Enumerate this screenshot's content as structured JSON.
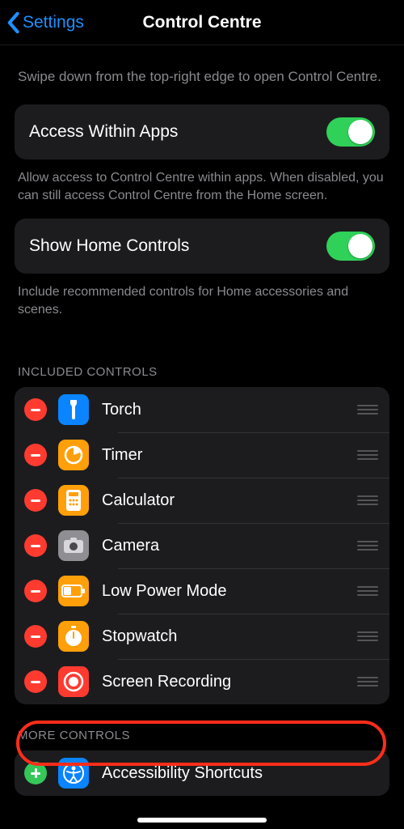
{
  "nav": {
    "back_label": "Settings",
    "title": "Control Centre"
  },
  "intro": "Swipe down from the top-right edge to open Control Centre.",
  "access": {
    "label": "Access Within Apps",
    "on": true,
    "footer": "Allow access to Control Centre within apps. When disabled, you can still access Control Centre from the Home screen."
  },
  "home": {
    "label": "Show Home Controls",
    "on": true,
    "footer": "Include recommended controls for Home accessories and scenes."
  },
  "included": {
    "header": "INCLUDED CONTROLS",
    "items": [
      {
        "label": "Torch",
        "icon": "torch"
      },
      {
        "label": "Timer",
        "icon": "timer"
      },
      {
        "label": "Calculator",
        "icon": "calc"
      },
      {
        "label": "Camera",
        "icon": "camera"
      },
      {
        "label": "Low Power Mode",
        "icon": "lpm"
      },
      {
        "label": "Stopwatch",
        "icon": "stop"
      },
      {
        "label": "Screen Recording",
        "icon": "rec"
      }
    ]
  },
  "more": {
    "header": "MORE CONTROLS",
    "items": [
      {
        "label": "Accessibility Shortcuts",
        "icon": "acc"
      }
    ]
  }
}
